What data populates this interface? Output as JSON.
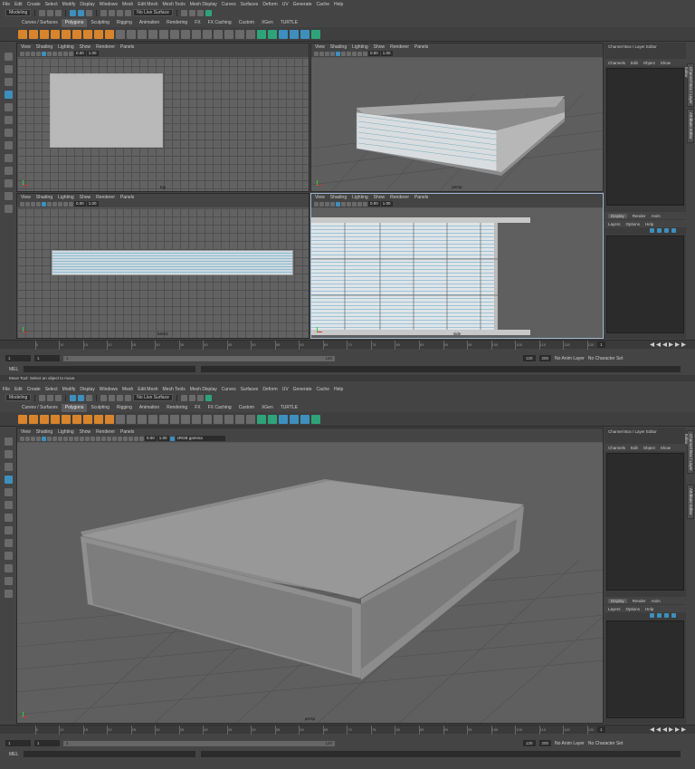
{
  "menus": [
    "File",
    "Edit",
    "Create",
    "Select",
    "Modify",
    "Display",
    "Windows",
    "Mesh",
    "Edit Mesh",
    "Mesh Tools",
    "Mesh Display",
    "Curves",
    "Surfaces",
    "Deform",
    "UV",
    "Generate",
    "Cache",
    "Help"
  ],
  "workspace": "Modeling",
  "live_surface": "No Live Surface",
  "shelf_tabs": [
    "Curves / Surfaces",
    "Polygons",
    "Sculpting",
    "Rigging",
    "Animation",
    "Rendering",
    "FX",
    "FX Caching",
    "Custom",
    "XGen",
    "TURTLE"
  ],
  "panel_menu": [
    "View",
    "Shading",
    "Lighting",
    "Show",
    "Renderer",
    "Panels"
  ],
  "vp_num1": "0.00",
  "vp_num2": "1.00",
  "color_space": "sRGB gamma",
  "views": {
    "top": "top",
    "persp": "persp",
    "back": "back1",
    "side": "side"
  },
  "channel_box": {
    "title": "Channel Box / Layer Editor",
    "tabs": [
      "Channels",
      "Edit",
      "Object",
      "Show"
    ]
  },
  "layer": {
    "tabs": [
      "Display",
      "Render",
      "Anim"
    ],
    "menu": [
      "Layers",
      "Options",
      "Help"
    ]
  },
  "side_tabs": [
    "Channel Box / Layer Editor",
    "Attribute Editor"
  ],
  "timeline_ticks": [
    "5",
    "10",
    "15",
    "20",
    "25",
    "30",
    "35",
    "40",
    "45",
    "50",
    "55",
    "60",
    "65",
    "70",
    "75",
    "80",
    "85",
    "90",
    "95",
    "100",
    "105",
    "110",
    "115",
    "120"
  ],
  "current_frame": "1",
  "range": {
    "start": "1",
    "start2": "1",
    "slider_start": "1",
    "slider_end": "120",
    "end": "120",
    "end2": "200"
  },
  "anim_layer": "No Anim Layer",
  "char_set": "No Character Set",
  "mel": "MEL",
  "help_text": "Move Tool: Select an object to move."
}
